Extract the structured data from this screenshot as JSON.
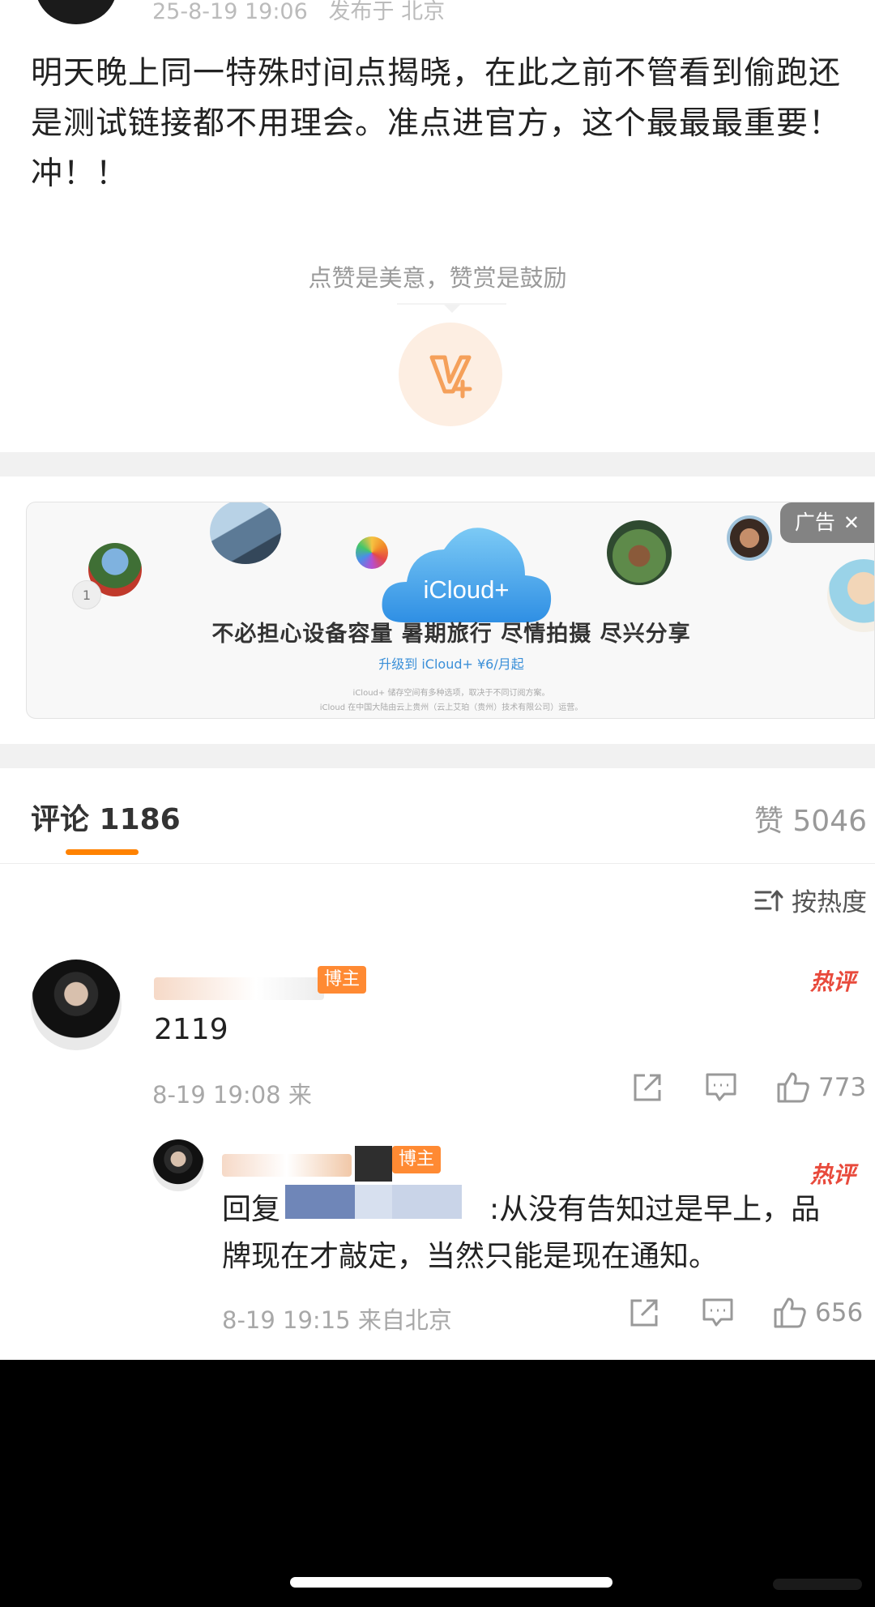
{
  "post": {
    "meta_time": "25-8-19 19:06",
    "meta_from": "发布于 北京",
    "text": "明天晚上同一特殊时间点揭晓，在此之前不管看到偷跑还是测试链接都不用理会。准点进官方，这个最最最重要！冲！！",
    "reward_tip": "点赞是美意，赞赏是鼓励"
  },
  "ad": {
    "tag": "广告",
    "close": "✕",
    "brand": "iCloud+",
    "headline": "不必担心设备容量 暑期旅行 尽情拍摄 尽兴分享",
    "sub": "升级到 iCloud+ ¥6/月起",
    "fine1": "iCloud+ 储存空间有多种选项，取决于不同订阅方案。",
    "fine2": "iCloud 在中国大陆由云上贵州（云上艾珀（贵州）技术有限公司）运营。",
    "badge_number": "1"
  },
  "tabs": {
    "comments": "评论 1186",
    "likes": "赞 5046"
  },
  "sort": {
    "label": "按热度"
  },
  "comments": [
    {
      "badge": "博主",
      "hot": "热评",
      "text": "2119",
      "meta": "8-19 19:08 来",
      "likes": "773"
    },
    {
      "badge": "博主",
      "hot": "热评",
      "reply_prefix": "回复",
      "text_after": ":从没有告知过是早上，品",
      "text_line2": "牌现在才敲定，当然只能是现在通知。",
      "meta": "8-19 19:15 来自北京",
      "likes": "656"
    }
  ],
  "colors": {
    "accent": "#ff8200",
    "hot": "#e84a3c",
    "badge": "#ff8a33",
    "link": "#3a8fd8"
  },
  "icons": [
    "reward-v-icon",
    "sort-icon",
    "share-icon",
    "comment-icon",
    "like-icon",
    "ad-close-icon"
  ]
}
